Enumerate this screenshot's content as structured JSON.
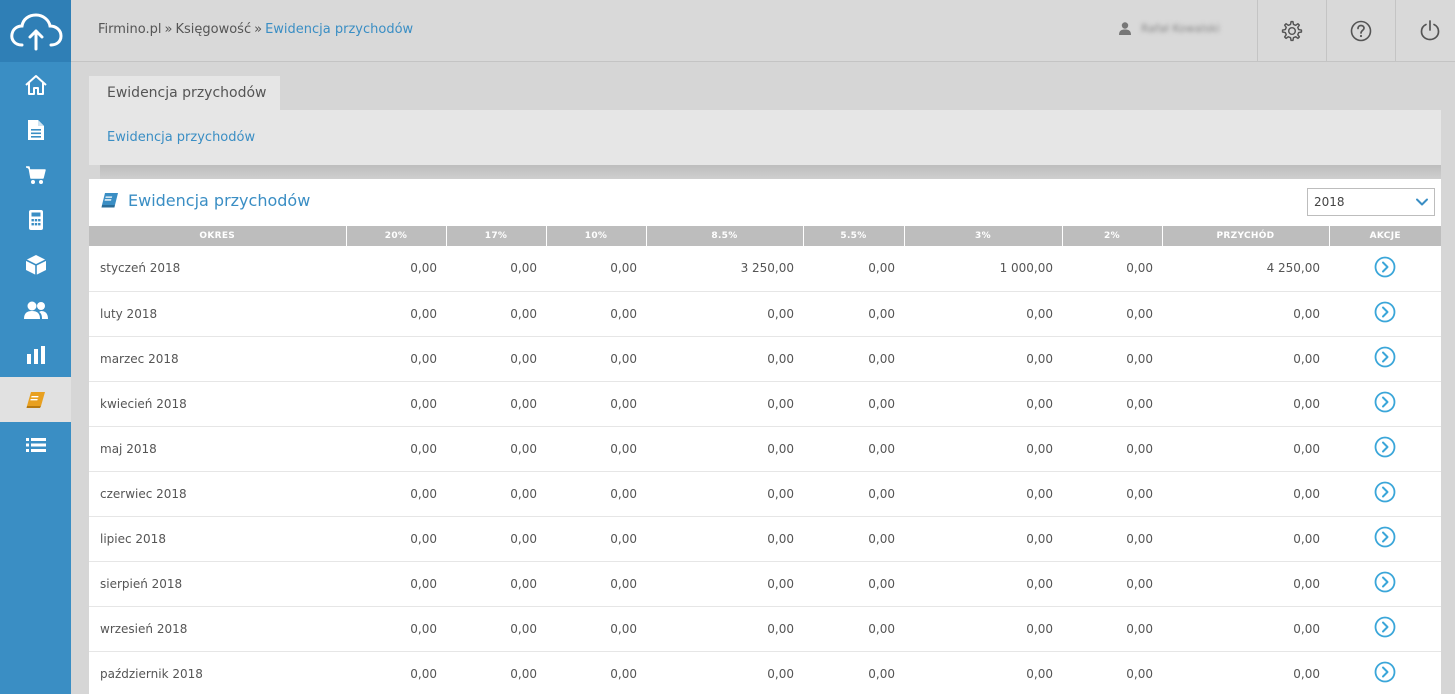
{
  "header": {
    "breadcrumb": [
      "Firmino.pl",
      "Księgowość",
      "Ewidencja przychodów"
    ],
    "breadcrumb_sep": "»",
    "user_name": "Rafał Kowalski"
  },
  "tabs": [
    {
      "label": "Ewidencja przychodów"
    }
  ],
  "subnav": {
    "link": "Ewidencja przychodów"
  },
  "card": {
    "title": "Ewidencja przychodów",
    "year": "2018"
  },
  "table": {
    "columns": [
      "OKRES",
      "20%",
      "17%",
      "10%",
      "8.5%",
      "5.5%",
      "3%",
      "2%",
      "PRZYCHÓD",
      "AKCJE"
    ],
    "rows": [
      [
        "styczeń 2018",
        "0,00",
        "0,00",
        "0,00",
        "3 250,00",
        "0,00",
        "1 000,00",
        "0,00",
        "4 250,00"
      ],
      [
        "luty 2018",
        "0,00",
        "0,00",
        "0,00",
        "0,00",
        "0,00",
        "0,00",
        "0,00",
        "0,00"
      ],
      [
        "marzec 2018",
        "0,00",
        "0,00",
        "0,00",
        "0,00",
        "0,00",
        "0,00",
        "0,00",
        "0,00"
      ],
      [
        "kwiecień 2018",
        "0,00",
        "0,00",
        "0,00",
        "0,00",
        "0,00",
        "0,00",
        "0,00",
        "0,00"
      ],
      [
        "maj 2018",
        "0,00",
        "0,00",
        "0,00",
        "0,00",
        "0,00",
        "0,00",
        "0,00",
        "0,00"
      ],
      [
        "czerwiec 2018",
        "0,00",
        "0,00",
        "0,00",
        "0,00",
        "0,00",
        "0,00",
        "0,00",
        "0,00"
      ],
      [
        "lipiec 2018",
        "0,00",
        "0,00",
        "0,00",
        "0,00",
        "0,00",
        "0,00",
        "0,00",
        "0,00"
      ],
      [
        "sierpień 2018",
        "0,00",
        "0,00",
        "0,00",
        "0,00",
        "0,00",
        "0,00",
        "0,00",
        "0,00"
      ],
      [
        "wrzesień 2018",
        "0,00",
        "0,00",
        "0,00",
        "0,00",
        "0,00",
        "0,00",
        "0,00",
        "0,00"
      ],
      [
        "październik 2018",
        "0,00",
        "0,00",
        "0,00",
        "0,00",
        "0,00",
        "0,00",
        "0,00",
        "0,00"
      ]
    ]
  },
  "sidebar": {
    "items": [
      {
        "icon": "home-icon",
        "active": false
      },
      {
        "icon": "document-icon",
        "active": false
      },
      {
        "icon": "cart-icon",
        "active": false
      },
      {
        "icon": "calculator-icon",
        "active": false
      },
      {
        "icon": "box-icon",
        "active": false
      },
      {
        "icon": "users-icon",
        "active": false
      },
      {
        "icon": "bar-chart-icon",
        "active": false
      },
      {
        "icon": "ledger-book-icon",
        "active": true
      },
      {
        "icon": "list-icon",
        "active": false
      }
    ]
  },
  "colors": {
    "accent": "#3a8ec4",
    "sidebar": "#3a8ec4",
    "active_icon": "#e8a020",
    "header_row": "#bdbdbd"
  }
}
